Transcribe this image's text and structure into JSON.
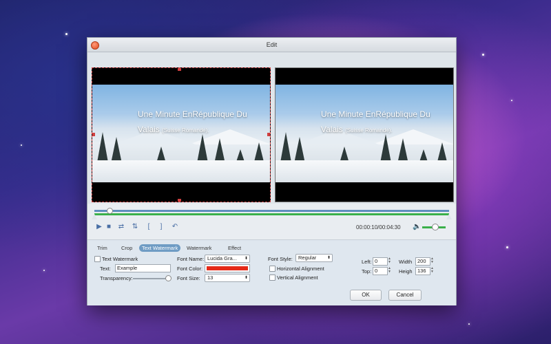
{
  "window": {
    "title": "Edit"
  },
  "preview": {
    "watermark_line1": "Une Minute EnRépublique Du",
    "watermark_line2": "Valais",
    "watermark_line2_small": "(Suisse Romande)."
  },
  "player": {
    "time_current": "00:00:10",
    "time_separator": "/",
    "time_total": "00:04:30"
  },
  "tabs": [
    {
      "label": "Trim"
    },
    {
      "label": "Crop"
    },
    {
      "label": "Text Watermark",
      "active": true
    },
    {
      "label": "Watermark"
    },
    {
      "label": "Effect"
    }
  ],
  "text_watermark": {
    "enable_label": "Text Watermark",
    "text_label": "Text:",
    "text_value": "Example",
    "transparency_label": "Transparency:",
    "transparency_value": 1.0,
    "font_name_label": "Font Name:",
    "font_name_value": "Lucida Gra...",
    "font_color_label": "Font Color:",
    "font_color_value": "#e52a18",
    "font_size_label": "Font Size:",
    "font_size_value": "13",
    "font_style_label": "Font Style:",
    "font_style_value": "Regular",
    "horizontal_alignment_label": "Horizontal Alignment",
    "vertical_alignment_label": "Vertical Alignment",
    "left_label": "Left:",
    "left_value": "0",
    "top_label": "Top:",
    "top_value": "0",
    "width_label": "Width",
    "width_value": "200",
    "height_label": "Heigh",
    "height_value": "136"
  },
  "footer": {
    "ok_label": "OK",
    "cancel_label": "Cancel"
  },
  "colors": {
    "accent": "#6f9cc4",
    "timeline_green": "#3ab04a",
    "timeline_blue": "#5f8fbf"
  },
  "icons": {
    "play": "play-icon",
    "stop": "stop-icon",
    "flip_h": "flip-horizontal-icon",
    "flip_v": "flip-vertical-icon",
    "mark_in": "mark-in-icon",
    "mark_out": "mark-out-icon",
    "undo": "undo-icon",
    "volume": "volume-icon"
  }
}
